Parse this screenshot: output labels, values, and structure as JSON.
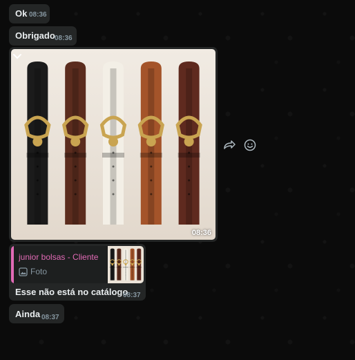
{
  "messages": {
    "ok": {
      "text": "Ok",
      "time": "08:36"
    },
    "obrigado": {
      "text": "Obrigado",
      "time": "08:36"
    },
    "image": {
      "time": "08:36",
      "belt_colors": [
        "#1b1b1b",
        "#5b2c1e",
        "#f3efe6",
        "#a4542a",
        "#5f2a1f"
      ],
      "buckle_color": "#c9a451"
    },
    "reply": {
      "quoted_author": "junior bolsas - Cliente",
      "quoted_type": "Foto",
      "quoted_accent": "#e26ab6",
      "text": "Esse não está no catálogo",
      "time": "08:37"
    },
    "ainda": {
      "text": "Ainda",
      "time": "08:37"
    }
  },
  "actions": {
    "forward_icon": "forward-icon",
    "react_icon": "emoji-icon",
    "menu_icon": "chevron-down-icon"
  }
}
